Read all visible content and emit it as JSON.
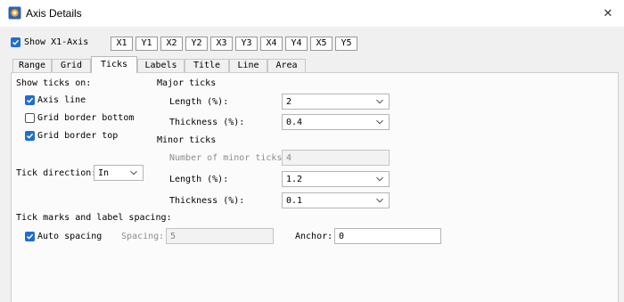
{
  "window": {
    "title": "Axis Details",
    "close_glyph": "✕"
  },
  "show_axis": {
    "label": "Show X1-Axis",
    "checked": true
  },
  "axis_buttons": [
    "X1",
    "Y1",
    "X2",
    "Y2",
    "X3",
    "Y3",
    "X4",
    "Y4",
    "X5",
    "Y5"
  ],
  "tabs": [
    "Range",
    "Grid",
    "Ticks",
    "Labels",
    "Title",
    "Line",
    "Area"
  ],
  "active_tab": "Ticks",
  "show_ticks": {
    "heading": "Show ticks on:",
    "axis_line": "Axis line",
    "grid_border_bottom": "Grid border bottom",
    "grid_border_top": "Grid border top"
  },
  "tick_direction": {
    "label": "Tick direction:",
    "value": "In"
  },
  "major": {
    "heading": "Major ticks",
    "length_label": "Length (%):",
    "length_value": "2",
    "thickness_label": "Thickness (%):",
    "thickness_value": "0.4"
  },
  "minor": {
    "heading": "Minor ticks",
    "count_label": "Number of minor ticks:",
    "count_value": "4",
    "length_label": "Length (%):",
    "length_value": "1.2",
    "thickness_label": "Thickness (%):",
    "thickness_value": "0.1"
  },
  "spacing": {
    "heading": "Tick marks and label spacing:",
    "auto_label": "Auto spacing",
    "spacing_label": "Spacing:",
    "spacing_value": "5",
    "anchor_label": "Anchor:",
    "anchor_value": "0"
  }
}
